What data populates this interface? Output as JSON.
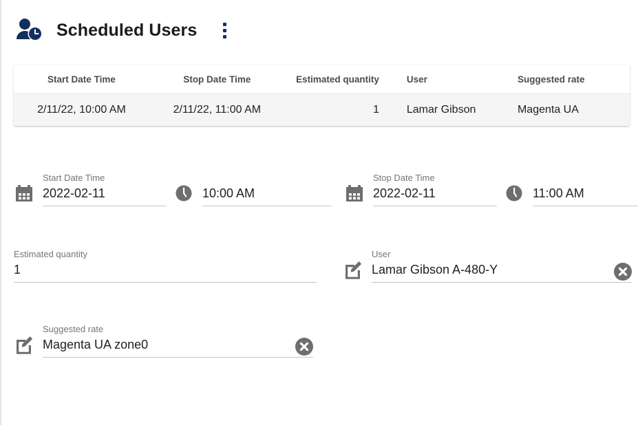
{
  "header": {
    "icon": "scheduled-user-clock-icon",
    "title": "Scheduled Users",
    "menu_icon": "more-vertical-icon",
    "accent_color": "#12305f"
  },
  "table": {
    "columns": [
      "Start Date Time",
      "Stop Date Time",
      "Estimated quantity",
      "User",
      "Suggested rate"
    ],
    "rows": [
      {
        "start_date_time": "2/11/22, 10:00 AM",
        "stop_date_time": "2/11/22, 11:00 AM",
        "estimated_quantity": "1",
        "user": "Lamar Gibson",
        "suggested_rate": "Magenta UA"
      }
    ],
    "header_text_color": "#4c4c4c",
    "row_background": "#f5f5f5"
  },
  "form": {
    "start_date": {
      "icon": "calendar-icon",
      "label": "Start Date Time",
      "value": "2022-02-11"
    },
    "start_time": {
      "icon": "clock-icon",
      "label": "",
      "value": "10:00 AM"
    },
    "stop_date": {
      "icon": "calendar-icon",
      "label": "Stop Date Time",
      "value": "2022-02-11"
    },
    "stop_time": {
      "icon": "clock-icon",
      "label": "",
      "value": "11:00 AM"
    },
    "estimated_quantity": {
      "label": "Estimated quantity",
      "value": "1"
    },
    "user": {
      "icon": "edit-square-icon",
      "label": "User",
      "value": "Lamar Gibson A-480-Y",
      "clear_icon": "clear-circle-icon"
    },
    "suggested_rate": {
      "icon": "edit-square-icon",
      "label": "Suggested rate",
      "value": "Magenta UA zone0",
      "clear_icon": "clear-circle-icon"
    },
    "label_color": "#757575",
    "value_color": "#212121",
    "icon_color": "#6e6e6e"
  }
}
